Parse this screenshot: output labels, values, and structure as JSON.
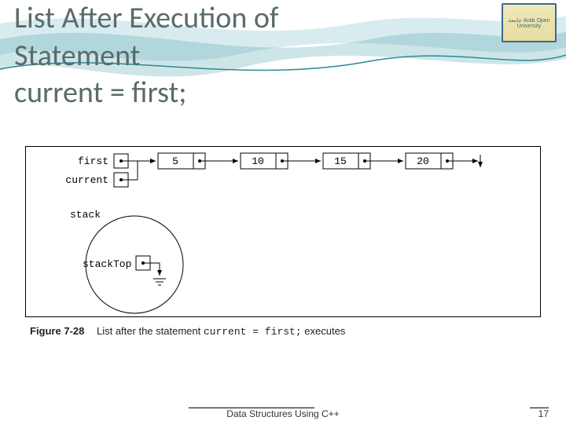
{
  "slide": {
    "title_line1": "List After Execution of",
    "title_line2": "Statement",
    "title_line3": "current = first;"
  },
  "logo": {
    "text": "جامعة\nArab Open University"
  },
  "diagram": {
    "pointers": {
      "first": "first",
      "current": "current"
    },
    "nodes": [
      "5",
      "10",
      "15",
      "20"
    ],
    "stack": {
      "label": "stack",
      "top_label": "stackTop"
    }
  },
  "caption": {
    "figure_label": "Figure 7-28",
    "prefix": "List after the statement ",
    "code": "current = first;",
    "suffix": " executes"
  },
  "footer": {
    "text": "Data Structures Using C++",
    "page": "17"
  }
}
